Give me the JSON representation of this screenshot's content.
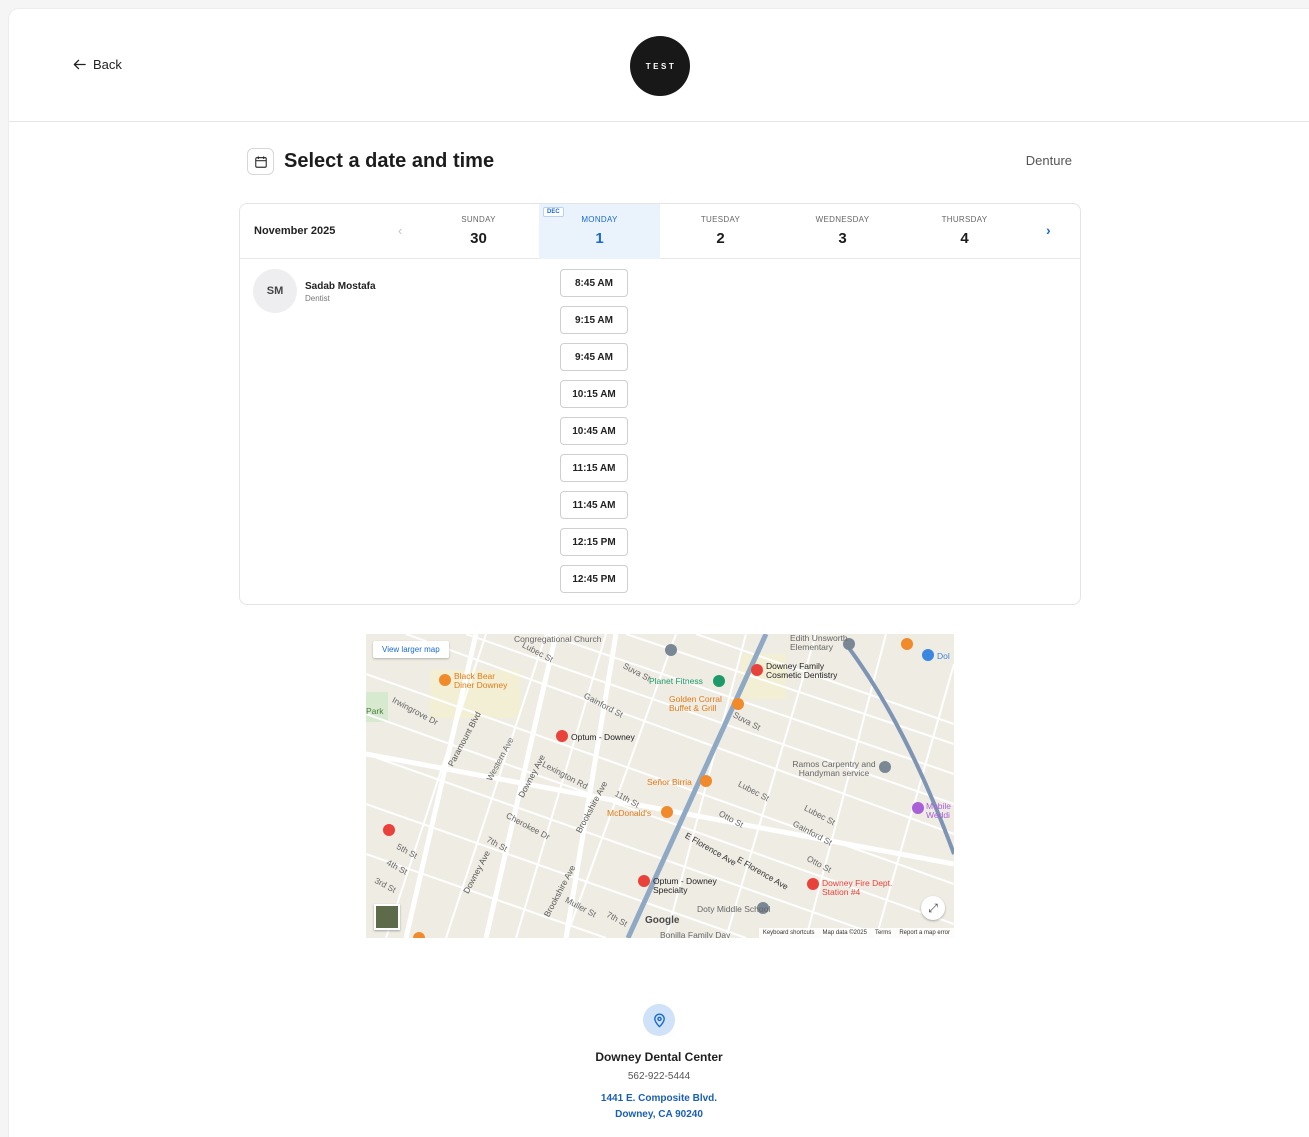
{
  "header": {
    "back_label": "Back",
    "logo_text": "TEST"
  },
  "page": {
    "title": "Select a date and time",
    "service": "Denture"
  },
  "calendar": {
    "month_label": "November 2025",
    "days": [
      {
        "name": "SUNDAY",
        "num": "30"
      },
      {
        "name": "MONDAY",
        "num": "1",
        "badge": "DEC"
      },
      {
        "name": "TUESDAY",
        "num": "2"
      },
      {
        "name": "WEDNESDAY",
        "num": "3"
      },
      {
        "name": "THURSDAY",
        "num": "4"
      }
    ],
    "selected_day_index": 1,
    "colors": {
      "accent": "#1a6ad0",
      "selected_bg": "#eaf3fb"
    }
  },
  "provider": {
    "initials": "SM",
    "name": "Sadab Mostafa",
    "role": "Dentist"
  },
  "slots": [
    "8:45 AM",
    "9:15 AM",
    "9:45 AM",
    "10:15 AM",
    "10:45 AM",
    "11:15 AM",
    "11:45 AM",
    "12:15 PM",
    "12:45 PM"
  ],
  "map": {
    "view_larger": "View larger map",
    "google": "Google",
    "attribution": {
      "shortcuts": "Keyboard shortcuts",
      "data": "Map data ©2025",
      "terms": "Terms",
      "report": "Report a map error"
    },
    "places": {
      "church": "Congregational Church",
      "edith": "Edith Unsworth Elementary",
      "downey_family": "Downey Family Cosmetic Dentistry",
      "black_bear": "Black Bear Diner Downey",
      "planet_fitness": "Planet Fitness",
      "golden_corral": "Golden Corral Buffet & Grill",
      "optum": "Optum - Downey",
      "ramos": "Ramos Carpentry and Handyman service",
      "senor": "Señor Birria",
      "mcdonalds": "McDonald's",
      "optum_specialty": "Optum - Downey Specialty",
      "fire": "Downey Fire Dept. Station #4",
      "doty": "Doty Middle School",
      "bonilla": "Bonilla Family Day",
      "mobile": "Mobile Weddi",
      "dol": "Dol",
      "park": "Park"
    },
    "streets": {
      "florence": "E Florence Ave",
      "paramount": "Paramount Blvd",
      "downey": "Downey Ave",
      "brookshire": "Brookshire Ave",
      "lubec": "Lubec St",
      "suva": "Suva St",
      "otto": "Otto St",
      "gainford": "Gainford St",
      "seventh": "7th St",
      "eleventh": "11th St",
      "lexington": "Lexington Rd",
      "western": "Western Ave",
      "cherokee": "Cherokee Dr",
      "fifth": "5th St",
      "fourth": "4th St",
      "third": "3rd St",
      "muller": "Muller St",
      "irwingrove": "Irwingrove Dr"
    }
  },
  "location": {
    "name": "Downey Dental Center",
    "phone": "562-922-5444",
    "address_line1": "1441 E. Composite Blvd.",
    "address_line2": "Downey, CA 90240"
  }
}
